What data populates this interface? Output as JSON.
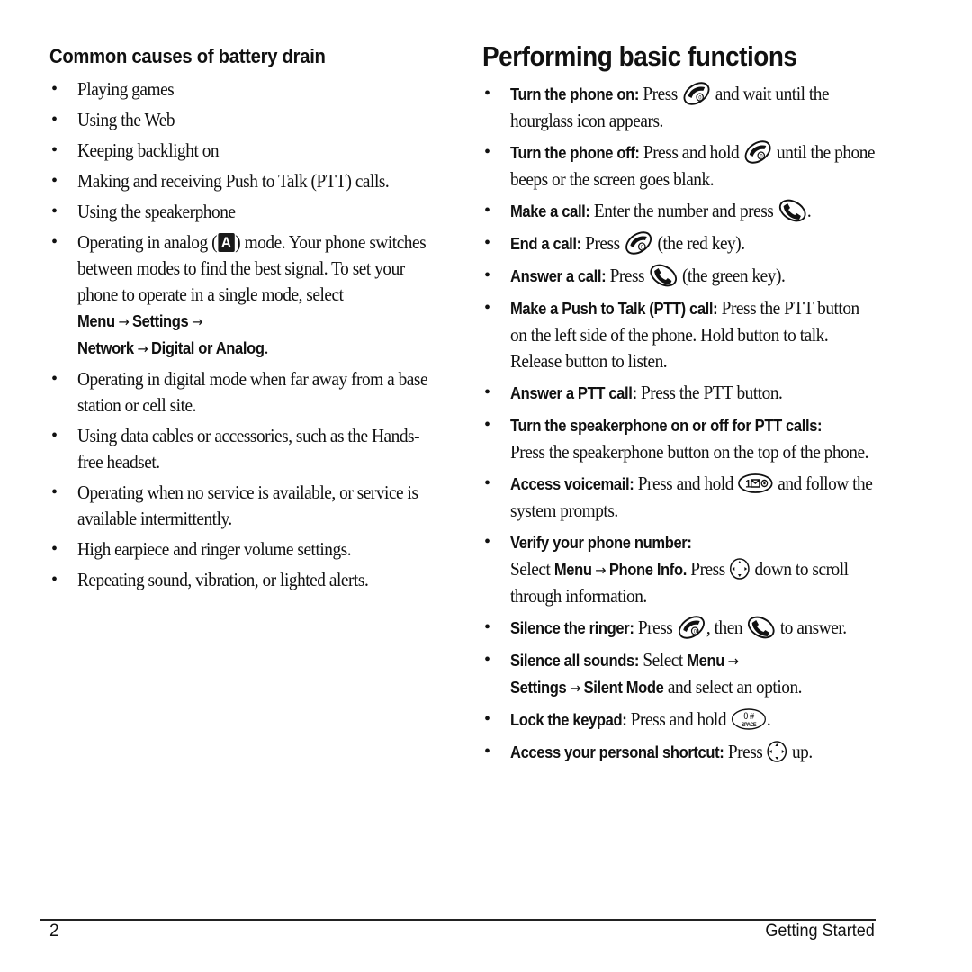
{
  "left": {
    "heading": "Common causes of battery drain",
    "items": [
      {
        "text": "Playing games"
      },
      {
        "text": "Using the Web"
      },
      {
        "text": "Keeping backlight on"
      },
      {
        "text": "Making and receiving Push to Talk (PTT) calls."
      },
      {
        "text": "Using the speakerphone"
      },
      {
        "pre": "Operating in analog (",
        "icon": "analog-mode-icon",
        "icon_letter": "A",
        "post": ") mode. Your phone switches between modes to find the best signal. To set your phone to operate in a single mode, select ",
        "path": [
          "Menu",
          "Settings",
          "Network",
          "Digital or Analog"
        ],
        "end": "."
      },
      {
        "text": "Operating in digital mode when far away from a base station or cell site."
      },
      {
        "text": "Using data cables or accessories, such as the Hands-free headset."
      },
      {
        "text": "Operating when no service is available, or service is available intermittently."
      },
      {
        "text": "High earpiece and ringer volume settings."
      },
      {
        "text": "Repeating sound, vibration, or lighted alerts."
      }
    ]
  },
  "right": {
    "heading": "Performing basic functions",
    "items": [
      {
        "label": "Turn the phone on:",
        "t1": " Press ",
        "icon1": "end-power-key-icon",
        "t2": " and wait until the hourglass icon appears."
      },
      {
        "label": "Turn the phone off:",
        "t1": " Press and hold ",
        "icon1": "end-power-key-icon",
        "t2": " until the phone beeps or the screen goes blank."
      },
      {
        "label": "Make a call:",
        "t1": " Enter the number and press ",
        "icon1": "send-key-icon",
        "t2": "."
      },
      {
        "label": "End a call:",
        "t1": " Press ",
        "icon1": "end-power-key-icon",
        "t2": " (the red key)."
      },
      {
        "label": "Answer a call:",
        "t1": " Press ",
        "icon1": "send-key-icon",
        "t2": " (the green key)."
      },
      {
        "label": "Make a Push to Talk (PTT) call:",
        "t1": " Press the PTT button on the left side of the phone. Hold button to talk. Release button to listen."
      },
      {
        "label": "Answer a PTT call:",
        "t1": " Press the PTT button."
      },
      {
        "label": "Turn the speakerphone on or off for PTT calls:",
        "t1": " Press the speakerphone button on the top of the phone."
      },
      {
        "label": "Access voicemail:",
        "t1": " Press and hold ",
        "icon1": "voicemail-1-key-icon",
        "t2": " and follow the system prompts."
      },
      {
        "label": "Verify your phone number:",
        "t1": "Select ",
        "path": [
          "Menu",
          "Phone Info."
        ],
        "t2": " Press ",
        "icon1": "navigation-key-icon",
        "t3": " down to scroll through information."
      },
      {
        "label": "Silence the ringer:",
        "t1": " Press ",
        "icon1": "end-power-key-icon",
        "t2": ", then ",
        "icon2": "send-key-icon",
        "t3": " to answer."
      },
      {
        "label": "Silence all sounds:",
        "t1": " Select ",
        "path": [
          "Menu",
          "Settings",
          "Silent Mode"
        ],
        "t2": " and select an option."
      },
      {
        "label": "Lock the keypad:",
        "t1": " Press and hold ",
        "icon1": "pound-space-key-icon",
        "t2": "."
      },
      {
        "label": "Access your personal shortcut:",
        "t1": " Press ",
        "icon1": "navigation-key-icon",
        "t2": " up."
      }
    ]
  },
  "footer": {
    "page_number": "2",
    "section": "Getting Started"
  },
  "symbols": {
    "arrow": "→",
    "voicemail_key_text": "1",
    "pound_key_text": "#",
    "space_key_text": "SPACE"
  }
}
